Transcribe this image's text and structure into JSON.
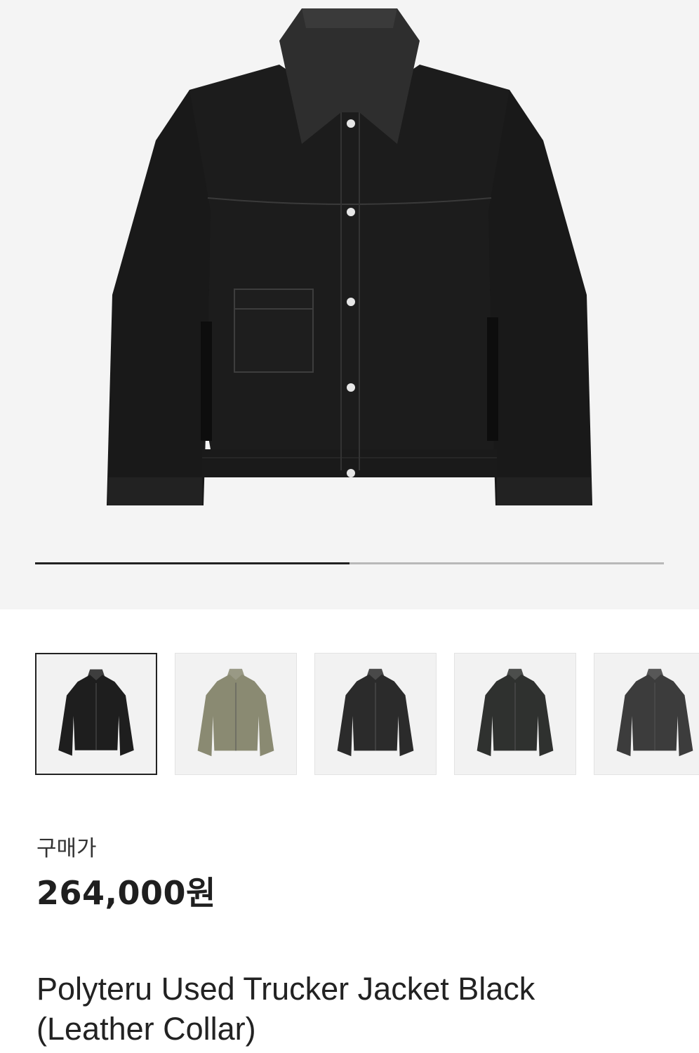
{
  "gallery": {
    "slide_progress_percent": 50,
    "thumbnails": [
      {
        "name": "thumb-black-leather-collar",
        "color": "#1e1e1e",
        "selected": true
      },
      {
        "name": "thumb-camo",
        "color": "#8a8a72",
        "selected": false
      },
      {
        "name": "thumb-charcoal-1",
        "color": "#2b2b2b",
        "selected": false
      },
      {
        "name": "thumb-charcoal-2",
        "color": "#2f312f",
        "selected": false
      },
      {
        "name": "thumb-grey",
        "color": "#3c3c3c",
        "selected": false
      }
    ]
  },
  "product": {
    "price_label": "구매가",
    "price": "264,000원",
    "title_line1": "Polyteru Used Trucker Jacket Black",
    "title_line2": "(Leather Collar)"
  }
}
